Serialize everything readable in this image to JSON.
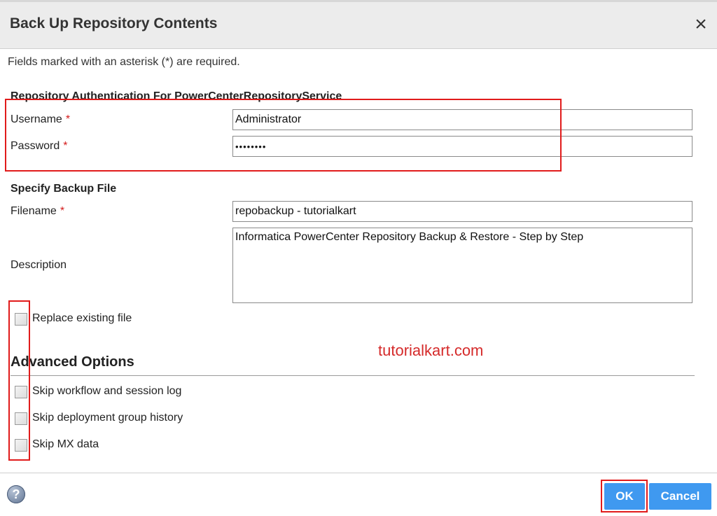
{
  "dialog": {
    "title": "Back Up Repository Contents",
    "close_icon": "×",
    "required_note": "Fields marked with an asterisk (*) are required."
  },
  "auth": {
    "section_title": "Repository Authentication For PowerCenterRepositoryService",
    "username_label": "Username",
    "username_value": "Administrator",
    "password_label": "Password",
    "password_value": "••••••••",
    "required_marker": "*"
  },
  "backup": {
    "section_title": "Specify Backup File",
    "filename_label": "Filename",
    "filename_value": "repobackup - tutorialkart",
    "description_label": "Description",
    "description_value": "Informatica PowerCenter Repository Backup & Restore - Step by Step",
    "replace_label": "Replace existing file"
  },
  "advanced": {
    "title": "Advanced Options",
    "options": [
      {
        "label": "Skip workflow and session log",
        "checked": false
      },
      {
        "label": "Skip deployment group history",
        "checked": false
      },
      {
        "label": "Skip MX data",
        "checked": false
      }
    ]
  },
  "watermark": "tutorialkart.com",
  "footer": {
    "help_icon": "?",
    "ok_label": "OK",
    "cancel_label": "Cancel"
  },
  "colors": {
    "button": "#3f99f0",
    "highlight": "#e11b1b",
    "required": "#d41c1c"
  }
}
